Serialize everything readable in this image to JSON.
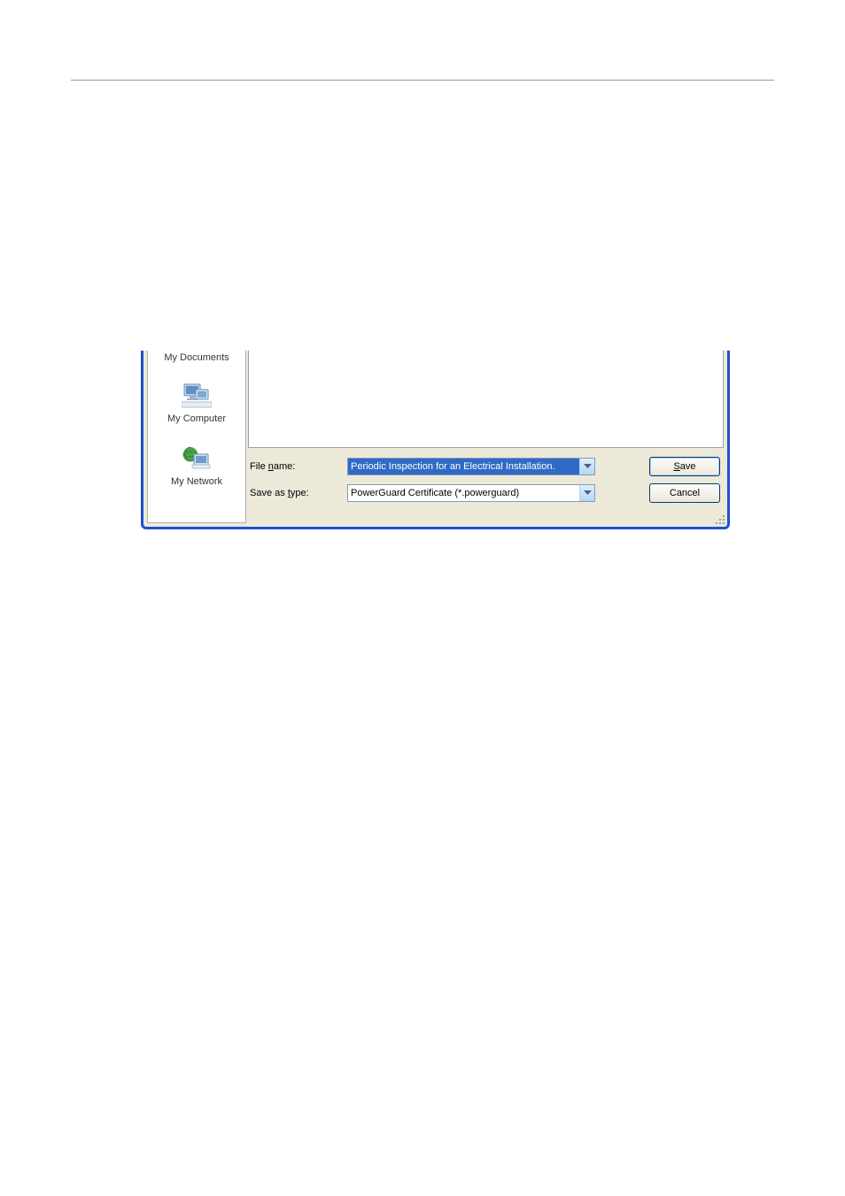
{
  "places": {
    "my_documents": "My Documents",
    "my_computer": "My Computer",
    "my_network": "My Network"
  },
  "form": {
    "file_name_label": "File name:",
    "file_name_value": "Periodic Inspection for an Electrical Installation.",
    "save_as_type_label": "Save as type:",
    "save_as_type_value": "PowerGuard Certificate (*.powerguard)"
  },
  "buttons": {
    "save": "Save",
    "cancel": "Cancel"
  }
}
